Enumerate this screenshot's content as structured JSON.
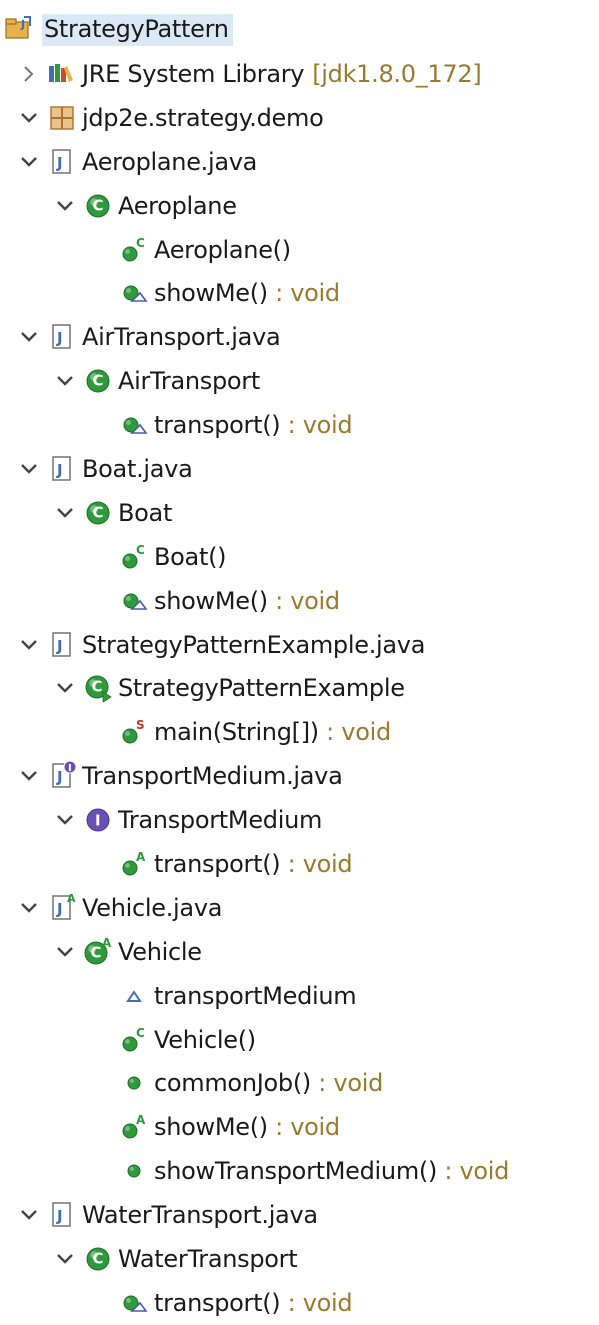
{
  "project": {
    "name": "StrategyPattern"
  },
  "colors": {
    "class_green": "#2e9a3c",
    "interface_purple": "#6a4fb5",
    "package_brown": "#b0702e",
    "java_file_blue": "#3f6fb0",
    "selection_bg": "#dbe9f6",
    "return_type": "#9a7a2c"
  },
  "rows": [
    {
      "depth": 0,
      "twisty": "none",
      "icon": "project-icon",
      "label": "StrategyPattern",
      "root": true
    },
    {
      "depth": 1,
      "twisty": "collapsed",
      "icon": "library-icon",
      "label": "JRE System Library",
      "extra": "[jdk1.8.0_172]"
    },
    {
      "depth": 1,
      "twisty": "expanded",
      "icon": "package-icon",
      "label": "jdp2e.strategy.demo"
    },
    {
      "depth": 2,
      "twisty": "expanded",
      "icon": "java-file-icon",
      "label": "Aeroplane.java"
    },
    {
      "depth": 3,
      "twisty": "expanded",
      "icon": "class-icon",
      "label": "Aeroplane"
    },
    {
      "depth": 4,
      "twisty": "none",
      "icon": "constructor-icon",
      "label": "Aeroplane()"
    },
    {
      "depth": 4,
      "twisty": "none",
      "icon": "override-method-icon",
      "label": "showMe()",
      "ret": " : void"
    },
    {
      "depth": 2,
      "twisty": "expanded",
      "icon": "java-file-icon",
      "label": "AirTransport.java"
    },
    {
      "depth": 3,
      "twisty": "expanded",
      "icon": "class-icon",
      "label": "AirTransport"
    },
    {
      "depth": 4,
      "twisty": "none",
      "icon": "override-method-icon",
      "label": "transport()",
      "ret": " : void"
    },
    {
      "depth": 2,
      "twisty": "expanded",
      "icon": "java-file-icon",
      "label": "Boat.java"
    },
    {
      "depth": 3,
      "twisty": "expanded",
      "icon": "class-icon",
      "label": "Boat"
    },
    {
      "depth": 4,
      "twisty": "none",
      "icon": "constructor-icon",
      "label": "Boat()"
    },
    {
      "depth": 4,
      "twisty": "none",
      "icon": "override-method-icon",
      "label": "showMe()",
      "ret": " : void"
    },
    {
      "depth": 2,
      "twisty": "expanded",
      "icon": "java-file-icon",
      "label": "StrategyPatternExample.java"
    },
    {
      "depth": 3,
      "twisty": "expanded",
      "icon": "runnable-class-icon",
      "label": "StrategyPatternExample"
    },
    {
      "depth": 4,
      "twisty": "none",
      "icon": "static-method-icon",
      "label": "main(String[])",
      "ret": " : void"
    },
    {
      "depth": 2,
      "twisty": "expanded",
      "icon": "java-interface-file-icon",
      "label": "TransportMedium.java"
    },
    {
      "depth": 3,
      "twisty": "expanded",
      "icon": "interface-icon",
      "label": "TransportMedium"
    },
    {
      "depth": 4,
      "twisty": "none",
      "icon": "abstract-method-icon",
      "label": "transport()",
      "ret": " : void"
    },
    {
      "depth": 2,
      "twisty": "expanded",
      "icon": "java-abstract-file-icon",
      "label": "Vehicle.java"
    },
    {
      "depth": 3,
      "twisty": "expanded",
      "icon": "abstract-class-icon",
      "label": "Vehicle"
    },
    {
      "depth": 4,
      "twisty": "none",
      "icon": "protected-field-icon",
      "label": "transportMedium"
    },
    {
      "depth": 4,
      "twisty": "none",
      "icon": "constructor-icon",
      "label": "Vehicle()"
    },
    {
      "depth": 4,
      "twisty": "none",
      "icon": "public-method-icon",
      "label": "commonJob()",
      "ret": " : void"
    },
    {
      "depth": 4,
      "twisty": "none",
      "icon": "abstract-method-icon",
      "label": "showMe()",
      "ret": " : void"
    },
    {
      "depth": 4,
      "twisty": "none",
      "icon": "public-method-icon",
      "label": "showTransportMedium()",
      "ret": " : void"
    },
    {
      "depth": 2,
      "twisty": "expanded",
      "icon": "java-file-icon",
      "label": "WaterTransport.java"
    },
    {
      "depth": 3,
      "twisty": "expanded",
      "icon": "class-icon",
      "label": "WaterTransport"
    },
    {
      "depth": 4,
      "twisty": "none",
      "icon": "override-method-icon",
      "label": "transport()",
      "ret": " : void"
    }
  ]
}
